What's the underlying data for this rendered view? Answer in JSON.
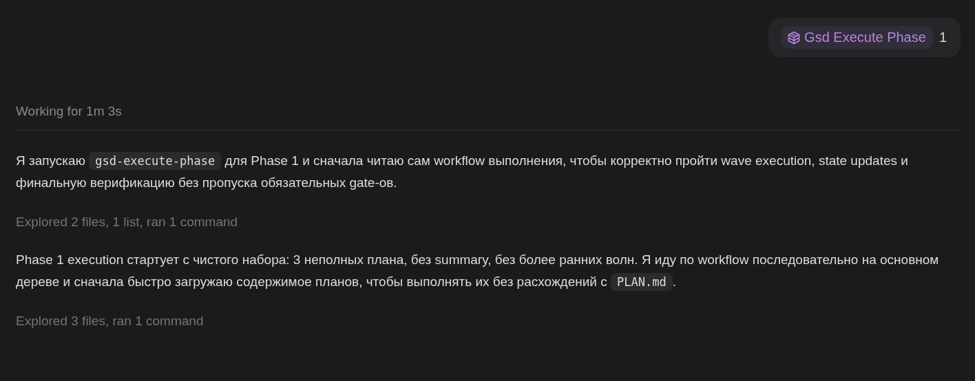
{
  "user_message": {
    "skill_chip": {
      "label": "Gsd Execute Phase"
    },
    "text": "1"
  },
  "status": "Working for 1m 3s",
  "items": [
    {
      "kind": "paragraph",
      "segments": [
        {
          "kind": "text",
          "text": "Я запускаю "
        },
        {
          "kind": "code",
          "text": "gsd-execute-phase"
        },
        {
          "kind": "text",
          "text": " для Phase 1 и сначала читаю сам workflow выполнения, чтобы корректно пройти wave execution, state updates и финальную верификацию без пропуска обязательных gate-ов."
        }
      ]
    },
    {
      "kind": "summary",
      "text": "Explored 2 files, 1 list, ran 1 command"
    },
    {
      "kind": "paragraph",
      "segments": [
        {
          "kind": "text",
          "text": "Phase 1 execution стартует с чистого набора: 3 неполных плана, без summary, без более ранних волн. Я иду по workflow последовательно на основном дереве и сначала быстро загружаю содержимое планов, чтобы выполнять их без расхождений с "
        },
        {
          "kind": "code",
          "text": "PLAN.md"
        },
        {
          "kind": "text",
          "text": "."
        }
      ]
    },
    {
      "kind": "summary",
      "text": "Explored 3 files, ran 1 command"
    }
  ]
}
